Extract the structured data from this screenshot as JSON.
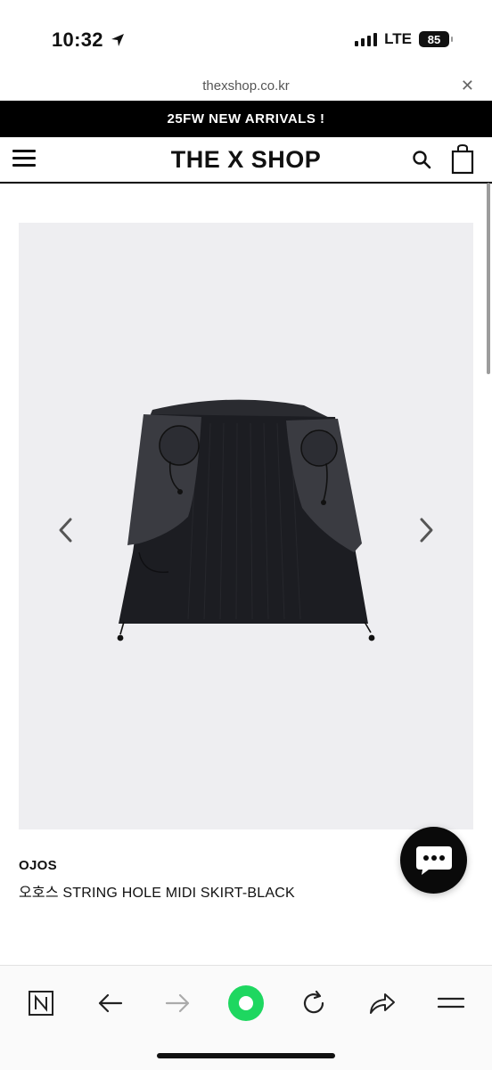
{
  "status_bar": {
    "time": "10:32",
    "carrier": "LTE",
    "battery": "85"
  },
  "browser": {
    "url": "thexshop.co.kr"
  },
  "banner": {
    "text": "25FW NEW ARRIVALS !"
  },
  "header": {
    "logo": "THE X SHOP"
  },
  "product": {
    "brand": "OJOS",
    "name": "오호스 STRING HOLE MIDI SKIRT-BLACK"
  },
  "colors": {
    "banner_bg": "#000000",
    "image_bg": "#eeeef1",
    "accent_green": "#1ed760"
  }
}
